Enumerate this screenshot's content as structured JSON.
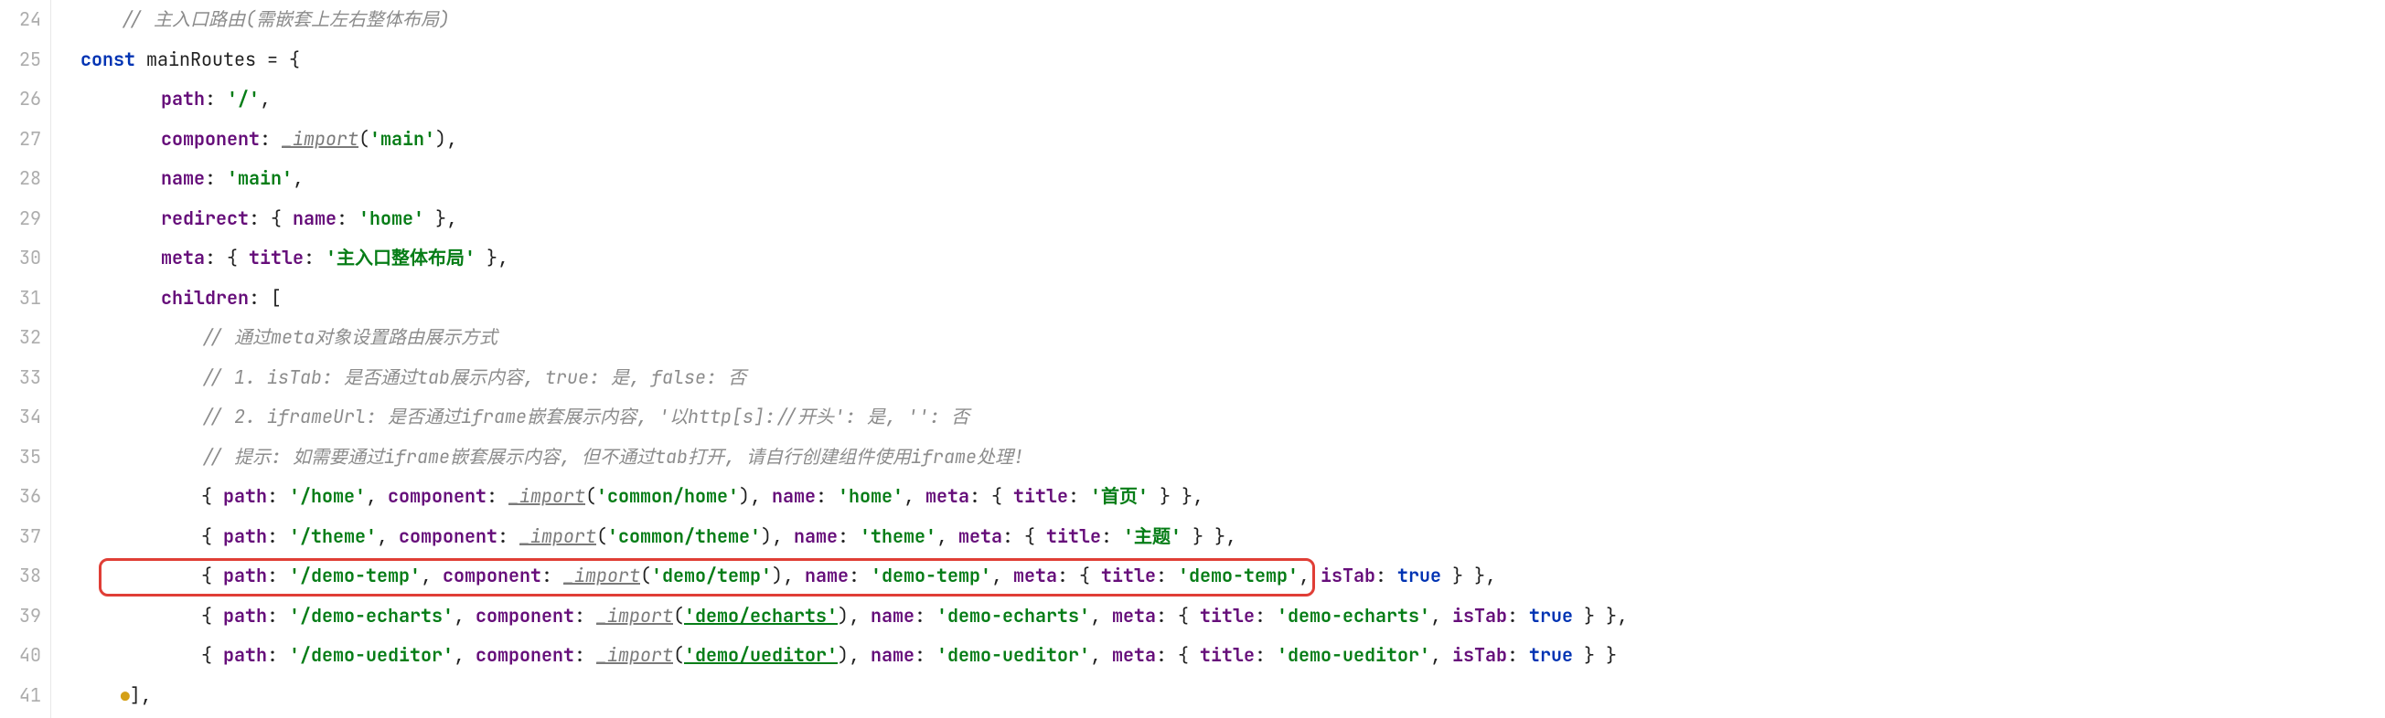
{
  "gutter": {
    "start": 24,
    "end": 41
  },
  "fold_markers": [
    "",
    "⊟",
    "",
    "",
    "",
    "",
    "",
    "⊟",
    "⊟",
    "",
    "",
    "⊟",
    "",
    "",
    "",
    "",
    "",
    "●],"
  ],
  "code_lines": [
    {
      "indent": 1,
      "tokens": [
        {
          "cls": "cmt",
          "t": "// 主入口路由(需嵌套上左右整体布局)"
        }
      ]
    },
    {
      "indent": 0,
      "tokens": [
        {
          "cls": "kw",
          "t": "const"
        },
        {
          "cls": "pun",
          "t": " mainRoutes = {"
        }
      ]
    },
    {
      "indent": 2,
      "tokens": [
        {
          "cls": "prop",
          "t": "path"
        },
        {
          "cls": "pun",
          "t": ": "
        },
        {
          "cls": "str",
          "t": "'/'"
        },
        {
          "cls": "pun",
          "t": ","
        }
      ]
    },
    {
      "indent": 2,
      "tokens": [
        {
          "cls": "prop",
          "t": "component"
        },
        {
          "cls": "pun",
          "t": ": "
        },
        {
          "cls": "fn-u",
          "t": "_import"
        },
        {
          "cls": "pun",
          "t": "("
        },
        {
          "cls": "str",
          "t": "'main'"
        },
        {
          "cls": "pun",
          "t": "),"
        }
      ]
    },
    {
      "indent": 2,
      "tokens": [
        {
          "cls": "prop",
          "t": "name"
        },
        {
          "cls": "pun",
          "t": ": "
        },
        {
          "cls": "str",
          "t": "'main'"
        },
        {
          "cls": "pun",
          "t": ","
        }
      ]
    },
    {
      "indent": 2,
      "tokens": [
        {
          "cls": "prop",
          "t": "redirect"
        },
        {
          "cls": "pun",
          "t": ": { "
        },
        {
          "cls": "prop",
          "t": "name"
        },
        {
          "cls": "pun",
          "t": ": "
        },
        {
          "cls": "str",
          "t": "'home'"
        },
        {
          "cls": "pun",
          "t": " },"
        }
      ]
    },
    {
      "indent": 2,
      "tokens": [
        {
          "cls": "prop",
          "t": "meta"
        },
        {
          "cls": "pun",
          "t": ": { "
        },
        {
          "cls": "prop",
          "t": "title"
        },
        {
          "cls": "pun",
          "t": ": "
        },
        {
          "cls": "str",
          "t": "'主入口整体布局'"
        },
        {
          "cls": "pun",
          "t": " },"
        }
      ]
    },
    {
      "indent": 2,
      "tokens": [
        {
          "cls": "prop",
          "t": "children"
        },
        {
          "cls": "pun",
          "t": ": ["
        }
      ]
    },
    {
      "indent": 3,
      "tokens": [
        {
          "cls": "cmt",
          "t": "// 通过meta对象设置路由展示方式"
        }
      ]
    },
    {
      "indent": 3,
      "tokens": [
        {
          "cls": "cmt",
          "t": "// 1. isTab: 是否通过tab展示内容, true: 是, false: 否"
        }
      ]
    },
    {
      "indent": 3,
      "tokens": [
        {
          "cls": "cmt",
          "t": "// 2. iframeUrl: 是否通过iframe嵌套展示内容, '以http[s]://开头': 是, '': 否"
        }
      ]
    },
    {
      "indent": 3,
      "tokens": [
        {
          "cls": "cmt",
          "t": "// 提示: 如需要通过iframe嵌套展示内容, 但不通过tab打开, 请自行创建组件使用iframe处理!"
        }
      ]
    },
    {
      "indent": 3,
      "tokens": [
        {
          "cls": "pun",
          "t": "{ "
        },
        {
          "cls": "prop",
          "t": "path"
        },
        {
          "cls": "pun",
          "t": ": "
        },
        {
          "cls": "str",
          "t": "'/home'"
        },
        {
          "cls": "pun",
          "t": ", "
        },
        {
          "cls": "prop",
          "t": "component"
        },
        {
          "cls": "pun",
          "t": ": "
        },
        {
          "cls": "fn-u",
          "t": "_import"
        },
        {
          "cls": "pun",
          "t": "("
        },
        {
          "cls": "str",
          "t": "'common/home'"
        },
        {
          "cls": "pun",
          "t": "), "
        },
        {
          "cls": "prop",
          "t": "name"
        },
        {
          "cls": "pun",
          "t": ": "
        },
        {
          "cls": "str",
          "t": "'home'"
        },
        {
          "cls": "pun",
          "t": ", "
        },
        {
          "cls": "prop",
          "t": "meta"
        },
        {
          "cls": "pun",
          "t": ": { "
        },
        {
          "cls": "prop",
          "t": "title"
        },
        {
          "cls": "pun",
          "t": ": "
        },
        {
          "cls": "str",
          "t": "'首页'"
        },
        {
          "cls": "pun",
          "t": " } },"
        }
      ]
    },
    {
      "indent": 3,
      "tokens": [
        {
          "cls": "pun",
          "t": "{ "
        },
        {
          "cls": "prop",
          "t": "path"
        },
        {
          "cls": "pun",
          "t": ": "
        },
        {
          "cls": "str",
          "t": "'/theme'"
        },
        {
          "cls": "pun",
          "t": ", "
        },
        {
          "cls": "prop",
          "t": "component"
        },
        {
          "cls": "pun",
          "t": ": "
        },
        {
          "cls": "fn-u",
          "t": "_import"
        },
        {
          "cls": "pun",
          "t": "("
        },
        {
          "cls": "str",
          "t": "'common/theme'"
        },
        {
          "cls": "pun",
          "t": "), "
        },
        {
          "cls": "prop",
          "t": "name"
        },
        {
          "cls": "pun",
          "t": ": "
        },
        {
          "cls": "str",
          "t": "'theme'"
        },
        {
          "cls": "pun",
          "t": ", "
        },
        {
          "cls": "prop",
          "t": "meta"
        },
        {
          "cls": "pun",
          "t": ": { "
        },
        {
          "cls": "prop",
          "t": "title"
        },
        {
          "cls": "pun",
          "t": ": "
        },
        {
          "cls": "str",
          "t": "'主题'"
        },
        {
          "cls": "pun",
          "t": " } },"
        }
      ]
    },
    {
      "indent": 3,
      "tokens": [
        {
          "cls": "pun",
          "t": "{ "
        },
        {
          "cls": "prop",
          "t": "path"
        },
        {
          "cls": "pun",
          "t": ": "
        },
        {
          "cls": "str",
          "t": "'/demo-temp'"
        },
        {
          "cls": "pun",
          "t": ", "
        },
        {
          "cls": "prop",
          "t": "component"
        },
        {
          "cls": "pun",
          "t": ": "
        },
        {
          "cls": "fn-u",
          "t": "_import"
        },
        {
          "cls": "pun",
          "t": "("
        },
        {
          "cls": "str",
          "t": "'demo/temp'"
        },
        {
          "cls": "pun",
          "t": "), "
        },
        {
          "cls": "prop",
          "t": "name"
        },
        {
          "cls": "pun",
          "t": ": "
        },
        {
          "cls": "str",
          "t": "'demo-temp'"
        },
        {
          "cls": "pun",
          "t": ", "
        },
        {
          "cls": "prop",
          "t": "meta"
        },
        {
          "cls": "pun",
          "t": ": { "
        },
        {
          "cls": "prop",
          "t": "title"
        },
        {
          "cls": "pun",
          "t": ": "
        },
        {
          "cls": "str",
          "t": "'demo-temp'"
        },
        {
          "cls": "pun",
          "t": ", "
        },
        {
          "cls": "prop",
          "t": "isTab"
        },
        {
          "cls": "pun",
          "t": ": "
        },
        {
          "cls": "bool",
          "t": "true"
        },
        {
          "cls": "pun",
          "t": " } },"
        }
      ]
    },
    {
      "indent": 3,
      "tokens": [
        {
          "cls": "pun",
          "t": "{ "
        },
        {
          "cls": "prop",
          "t": "path"
        },
        {
          "cls": "pun",
          "t": ": "
        },
        {
          "cls": "str",
          "t": "'/demo-echarts'"
        },
        {
          "cls": "pun",
          "t": ", "
        },
        {
          "cls": "prop",
          "t": "component"
        },
        {
          "cls": "pun",
          "t": ": "
        },
        {
          "cls": "fn-u",
          "t": "_import"
        },
        {
          "cls": "pun",
          "t": "("
        },
        {
          "cls": "str val-u",
          "t": "'demo/echarts'"
        },
        {
          "cls": "pun",
          "t": "), "
        },
        {
          "cls": "prop",
          "t": "name"
        },
        {
          "cls": "pun",
          "t": ": "
        },
        {
          "cls": "str",
          "t": "'demo-echarts'"
        },
        {
          "cls": "pun",
          "t": ", "
        },
        {
          "cls": "prop",
          "t": "meta"
        },
        {
          "cls": "pun",
          "t": ": { "
        },
        {
          "cls": "prop",
          "t": "title"
        },
        {
          "cls": "pun",
          "t": ": "
        },
        {
          "cls": "str",
          "t": "'demo-echarts'"
        },
        {
          "cls": "pun",
          "t": ", "
        },
        {
          "cls": "prop",
          "t": "isTab"
        },
        {
          "cls": "pun",
          "t": ": "
        },
        {
          "cls": "bool",
          "t": "true"
        },
        {
          "cls": "pun",
          "t": " } },"
        }
      ]
    },
    {
      "indent": 3,
      "tokens": [
        {
          "cls": "pun",
          "t": "{ "
        },
        {
          "cls": "prop",
          "t": "path"
        },
        {
          "cls": "pun",
          "t": ": "
        },
        {
          "cls": "str",
          "t": "'/demo-ueditor'"
        },
        {
          "cls": "pun",
          "t": ", "
        },
        {
          "cls": "prop",
          "t": "component"
        },
        {
          "cls": "pun",
          "t": ": "
        },
        {
          "cls": "fn-u",
          "t": "_import"
        },
        {
          "cls": "pun",
          "t": "("
        },
        {
          "cls": "str val-u",
          "t": "'demo/ueditor'"
        },
        {
          "cls": "pun",
          "t": "), "
        },
        {
          "cls": "prop",
          "t": "name"
        },
        {
          "cls": "pun",
          "t": ": "
        },
        {
          "cls": "str",
          "t": "'demo-ueditor'"
        },
        {
          "cls": "pun",
          "t": ", "
        },
        {
          "cls": "prop",
          "t": "meta"
        },
        {
          "cls": "pun",
          "t": ": { "
        },
        {
          "cls": "prop",
          "t": "title"
        },
        {
          "cls": "pun",
          "t": ": "
        },
        {
          "cls": "str",
          "t": "'demo-ueditor'"
        },
        {
          "cls": "pun",
          "t": ", "
        },
        {
          "cls": "prop",
          "t": "isTab"
        },
        {
          "cls": "pun",
          "t": ": "
        },
        {
          "cls": "bool",
          "t": "true"
        },
        {
          "cls": "pun",
          "t": " } }"
        }
      ]
    },
    {
      "indent": 1,
      "tokens": [
        {
          "cls": "ln-yellow-dot",
          "t": "●"
        },
        {
          "cls": "pun",
          "t": "],"
        }
      ]
    }
  ]
}
